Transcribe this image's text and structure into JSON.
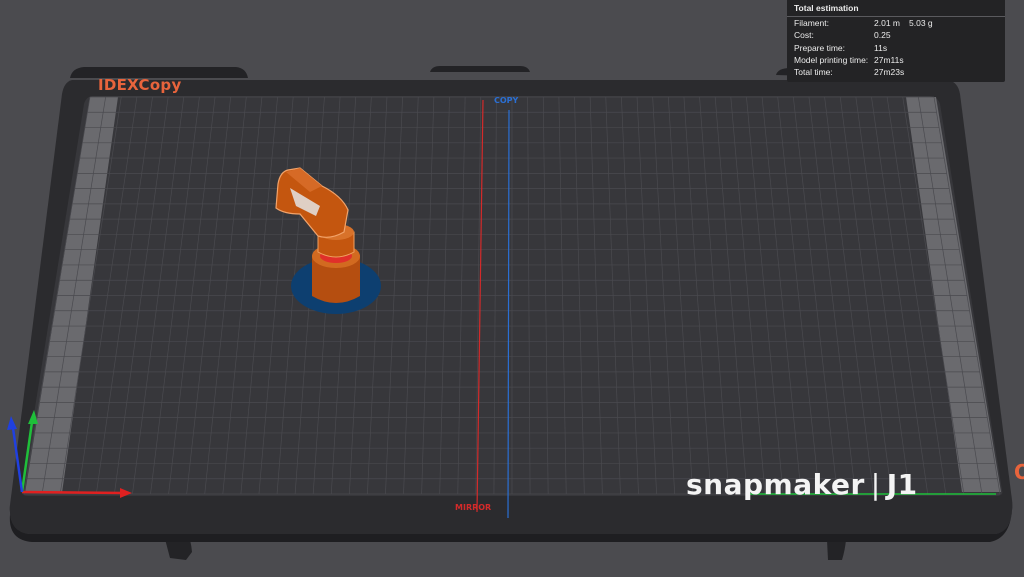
{
  "plate": {
    "mode_label": "IDEXCopy",
    "copy_label": "COPY",
    "mirror_label": "MIRROR",
    "brand_main": "snapmaker",
    "brand_divider": "|",
    "brand_model": "J1",
    "edge_glyph": "O"
  },
  "estimation": {
    "title": "Total estimation",
    "rows": [
      {
        "label": "Filament:",
        "value": "2.01 m",
        "value2": "5.03 g"
      },
      {
        "label": "Cost:",
        "value": "0.25"
      },
      {
        "label": "Prepare time:",
        "value": "11s"
      },
      {
        "label": "Model printing time:",
        "value": "27m11s"
      },
      {
        "label": "Total time:",
        "value": "27m23s"
      }
    ]
  },
  "colors": {
    "background": "#4b4b4f",
    "plate_dark": "#2b2b2e",
    "grid_surface": "#38383c",
    "mode_label": "#e8643c",
    "copy_line": "#2a6fd4",
    "mirror_line": "#d42a2a",
    "model": "#c4560f",
    "brim": "#0d3f70",
    "axis_x": "#e02020",
    "axis_y": "#1fbf3a",
    "axis_z": "#2040e0"
  },
  "icons": {
    "axis_gizmo": "xyz-axis-icon"
  }
}
